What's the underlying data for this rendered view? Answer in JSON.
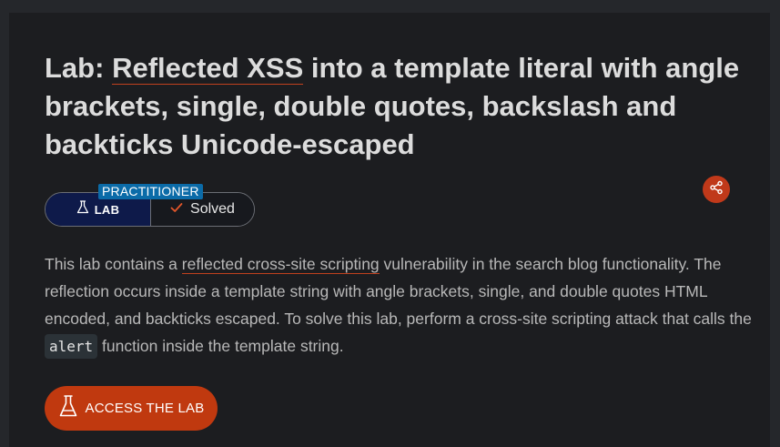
{
  "lab": {
    "title_prefix": "Lab: ",
    "title_link": "Reflected XSS",
    "title_rest": " into a template literal with angle brackets, single, double quotes, backslash and backticks Unicode-escaped",
    "level": "PRACTITIONER",
    "type_label": "LAB",
    "status": "Solved",
    "description": {
      "part1": "This lab contains a ",
      "link": "reflected cross-site scripting",
      "part2": " vulnerability in the search blog functionality. The reflection occurs inside a template string with angle brackets, single, and double quotes HTML encoded, and backticks escaped. To solve this lab, perform a cross-site scripting attack that calls the ",
      "code": "alert",
      "part3": " function inside the template string."
    },
    "access_button": "ACCESS THE LAB"
  },
  "icons": {
    "share": "share-icon",
    "flask": "flask-icon",
    "check": "check-icon"
  },
  "colors": {
    "accent": "#c0390f",
    "level_badge": "#0b6ba8",
    "lab_badge_bg": "#0e1a4a",
    "background": "#1c1d20"
  }
}
